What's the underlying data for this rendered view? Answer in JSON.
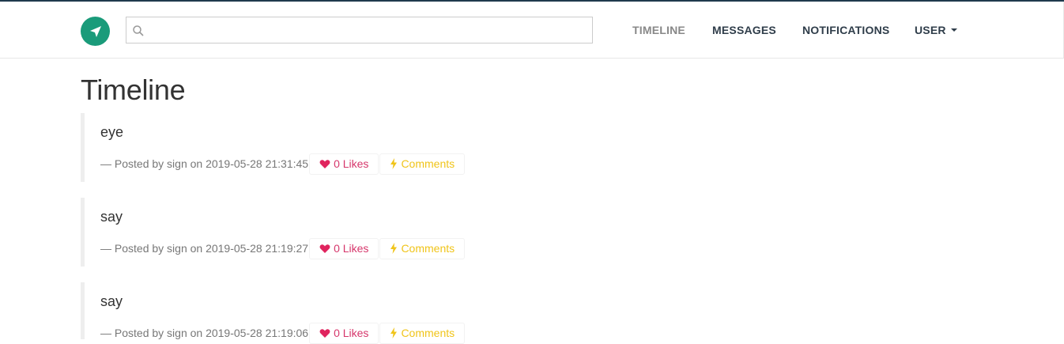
{
  "nav": {
    "search_placeholder": "",
    "links": [
      {
        "label": "TIMELINE",
        "active": true
      },
      {
        "label": "MESSAGES",
        "active": false
      },
      {
        "label": "NOTIFICATIONS",
        "active": false
      },
      {
        "label": "USER",
        "active": false
      }
    ]
  },
  "page": {
    "title": "Timeline"
  },
  "posts": [
    {
      "content": "eye",
      "meta": "— Posted by sign on 2019-05-28 21:31:45",
      "likes": "0 Likes",
      "comments": "Comments"
    },
    {
      "content": "say",
      "meta": "— Posted by sign on 2019-05-28 21:19:27",
      "likes": "0 Likes",
      "comments": "Comments"
    },
    {
      "content": "say",
      "meta": "— Posted by sign on 2019-05-28 21:19:06",
      "likes": "0 Likes",
      "comments": "Comments"
    }
  ],
  "colors": {
    "brand": "#1a9b7a",
    "likes": "#d6366b",
    "comments": "#f0c419"
  },
  "icons": {
    "logo": "paper-plane-icon",
    "search": "search-icon",
    "like": "heart-icon",
    "comment": "lightning-icon",
    "dropdown": "caret-down-icon"
  }
}
